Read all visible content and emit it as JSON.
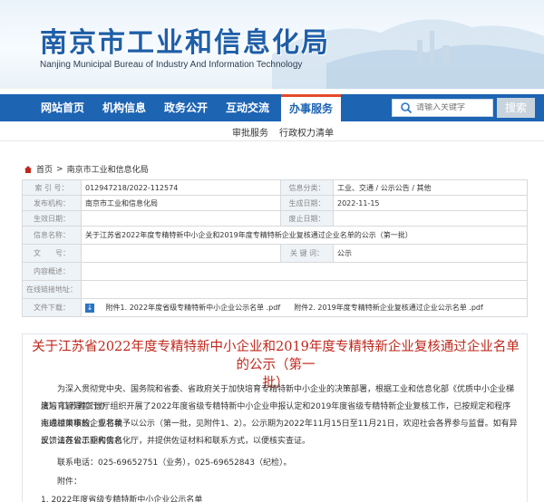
{
  "header": {
    "title": "南京市工业和信息化局",
    "subtitle": "Nanjing Municipal Bureau of Industry And Information Technology"
  },
  "nav": {
    "items": [
      {
        "label": "网站首页"
      },
      {
        "label": "机构信息"
      },
      {
        "label": "政务公开"
      },
      {
        "label": "互动交流"
      },
      {
        "label": "办事服务"
      }
    ],
    "active_index": 4,
    "search_placeholder": "请输入关键字",
    "search_button": "搜索"
  },
  "subnav": {
    "items": [
      {
        "label": "审批服务"
      },
      {
        "label": "行政权力清单"
      }
    ]
  },
  "breadcrumb": {
    "home": "首页",
    "separator": ">",
    "section": "南京市工业和信息化局"
  },
  "meta": {
    "index_label": "索 引 号：",
    "index_value": "012947218/2022-112574",
    "category_label": "信息分类：",
    "category_value": "工业、交通 / 公示公告 / 其他",
    "org_label": "发布机构：",
    "org_value": "南京市工业和信息化局",
    "gen_date_label": "生成日期：",
    "gen_date_value": "2022-11-15",
    "effective_label": "生效日期：",
    "effective_value": "",
    "abolish_label": "废止日期：",
    "abolish_value": "",
    "name_label": "信息名称：",
    "name_value": "关于江苏省2022年度专精特新中小企业和2019年度专精特新企业复核通过企业名单的公示（第一批）",
    "docno_label": "文　　号：",
    "docno_value": "",
    "keyword_label": "关 键 词：",
    "keyword_value": "公示",
    "summary_label": "内容概述：",
    "summary_value": "",
    "online_label": "在线链接地址：",
    "online_value": "",
    "attach_label": "文件下载：",
    "attachment_1": "附件1. 2022年度省级专精特新中小企业公示名单 .pdf",
    "attachment_2": "附件2. 2019年度专精特新企业复核通过企业公示名单 .pdf"
  },
  "article": {
    "title_line1": "关于江苏省2022年度专精特新中小企业和2019年度专精特新企业复核通过企业名单的公示（第一",
    "title_line2": "批）",
    "p1_l1": "为深入贯彻党中央、国务院和省委、省政府关于加快培育专精特新中小企业的决策部署，根据工业和信息化部《优质中小企业梯度培育管理暂行办",
    "p1_l2": "法》，江苏省工信厅组织开展了2022年度省级专精特新中小企业申报认定和2019年度省级专精特新企业复核工作，已按规定和程序完成相关审核，现将我",
    "p1_l3": "市通过审核的企业名单予以公示（第一批，见附件1、2）。公示期为2022年11月15日至11月21日，欢迎社会各界参与监督。如有异议，请在公示期内实名",
    "p1_l4": "反馈江苏省工业和信息化厅，并提供佐证材料和联系方式，以便核实查证。",
    "contact": "联系电话：025-69652751（业务），025-69652843（纪检）。",
    "attach_heading": "附件：",
    "attach_item": "1. 2022年度省级专精特新中小企业公示名单"
  },
  "colors": {
    "nav_blue": "#1d64b3",
    "title_red": "#c0281c",
    "active_accent": "#e34a2a"
  }
}
